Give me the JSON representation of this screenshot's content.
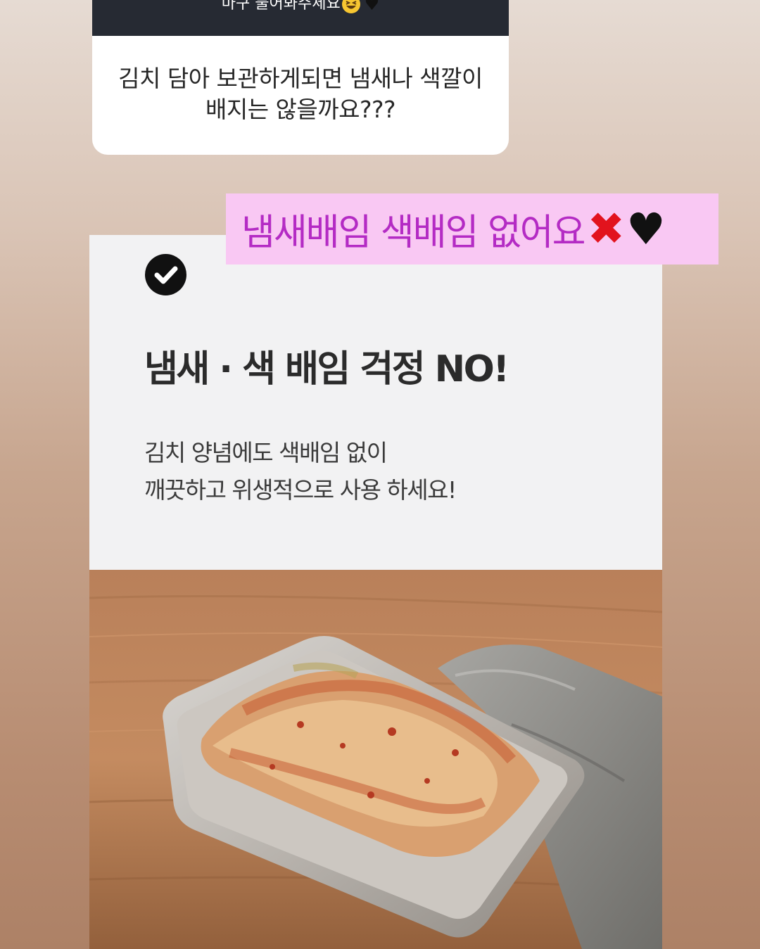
{
  "question_box": {
    "header_text": "마구 물어봐주세요",
    "header_emoji_1": "grinning-squint-face-emoji",
    "header_emoji_2": "♥",
    "question_line1": "김치 담아 보관하게되면 냄새나 색깔이",
    "question_line2": "배지는 않을까요???"
  },
  "overlay": {
    "text": "냄새배임 색배임 없어요",
    "x_emoji": "✖",
    "heart_emoji": "♥",
    "background": "#f9c8f3",
    "text_color": "#b42bc4"
  },
  "product_card": {
    "check_icon": "check-circle-icon",
    "headline": "냄새 · 색 배임 걱정 NO!",
    "desc_line1": "김치 양념에도 색배임 없이",
    "desc_line2": "깨끗하고 위생적으로 사용 하세요!",
    "photo_icon": "kimchi-container-photo"
  },
  "colors": {
    "header_bg": "#262a33",
    "card_bg": "#f2f2f3",
    "x_red": "#e2131d"
  }
}
